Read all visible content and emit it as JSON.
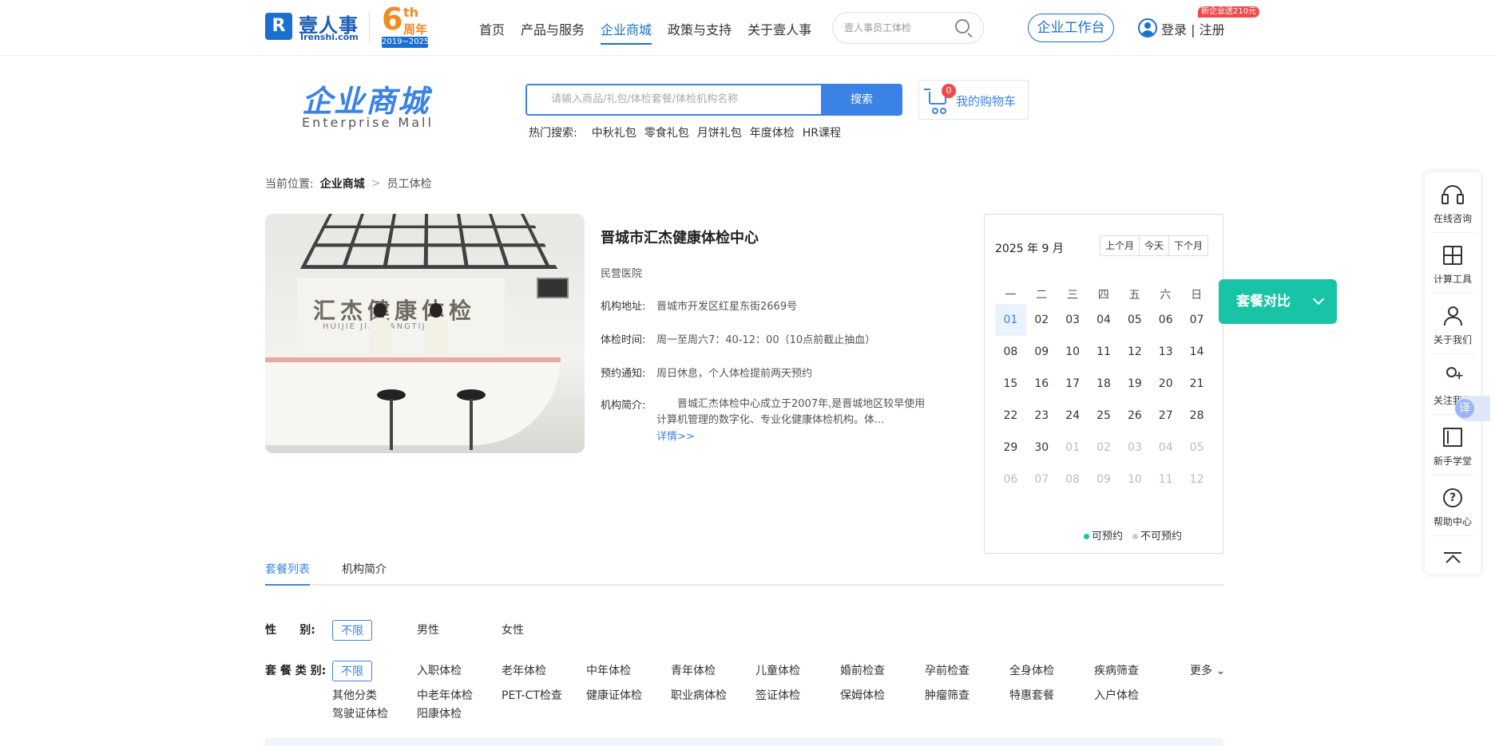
{
  "header": {
    "logo_mark": "R",
    "logo_text": "壹人事",
    "logo_sub": "Irenshi.com",
    "anniversary": {
      "num": "6",
      "th": "th",
      "word": "周年",
      "years": "2019~2025"
    },
    "nav": [
      {
        "label": "首页",
        "active": false
      },
      {
        "label": "产品与服务",
        "active": false
      },
      {
        "label": "企业商城",
        "active": true
      },
      {
        "label": "政策与支持",
        "active": false
      },
      {
        "label": "关于壹人事",
        "active": false
      }
    ],
    "search_placeholder": "壹人事员工体检",
    "workbench_label": "企业工作台",
    "login_label": "登录 | 注册",
    "promo_badge": "新企业送210元"
  },
  "mall": {
    "title": "企业商城",
    "subtitle": "Enterprise  Mall",
    "search_placeholder": "请输入商品/礼包/体检套餐/体检机构名称",
    "search_button": "搜索",
    "cart_count": "0",
    "cart_label": "我的购物车",
    "hot_label": "热门搜索:",
    "hot_items": [
      "中秋礼包",
      "零食礼包",
      "月饼礼包",
      "年度体检",
      "HR课程"
    ]
  },
  "breadcrumb": {
    "prefix": "当前位置:",
    "mall": "企业商城",
    "sep": ">",
    "current": "员工体检"
  },
  "institution": {
    "photo_sign": "汇杰健康体检",
    "photo_sign_sub": "HUIJIE JIANKANGTIJIAN",
    "name": "晋城市汇杰健康体检中心",
    "type": "民营医院",
    "address_label": "机构地址:",
    "address": "晋城市开发区红星东街2669号",
    "hours_label": "体检时间:",
    "hours": "周一至周六7：40-12：00（10点前截止抽血）",
    "notice_label": "预约通知:",
    "notice": "周日休息，个人体检提前两天预约",
    "intro_label": "机构简介:",
    "intro": "晋城汇杰体检中心成立于2007年,是晋城地区较早使用计算机管理的数字化、专业化健康体检机构。体...",
    "detail_link": "详情>>"
  },
  "calendar": {
    "title": "2025 年 9 月",
    "buttons": [
      "上个月",
      "今天",
      "下个月"
    ],
    "weekdays": [
      "一",
      "二",
      "三",
      "四",
      "五",
      "六",
      "日"
    ],
    "days": [
      {
        "d": "01",
        "state": "today"
      },
      {
        "d": "02",
        "state": "normal"
      },
      {
        "d": "03",
        "state": "normal"
      },
      {
        "d": "04",
        "state": "normal"
      },
      {
        "d": "05",
        "state": "normal"
      },
      {
        "d": "06",
        "state": "normal"
      },
      {
        "d": "07",
        "state": "normal"
      },
      {
        "d": "08",
        "state": "normal"
      },
      {
        "d": "09",
        "state": "normal"
      },
      {
        "d": "10",
        "state": "normal"
      },
      {
        "d": "11",
        "state": "normal"
      },
      {
        "d": "12",
        "state": "normal"
      },
      {
        "d": "13",
        "state": "normal"
      },
      {
        "d": "14",
        "state": "normal"
      },
      {
        "d": "15",
        "state": "normal"
      },
      {
        "d": "16",
        "state": "normal"
      },
      {
        "d": "17",
        "state": "normal"
      },
      {
        "d": "18",
        "state": "normal"
      },
      {
        "d": "19",
        "state": "normal"
      },
      {
        "d": "20",
        "state": "normal"
      },
      {
        "d": "21",
        "state": "normal"
      },
      {
        "d": "22",
        "state": "normal"
      },
      {
        "d": "23",
        "state": "normal"
      },
      {
        "d": "24",
        "state": "normal"
      },
      {
        "d": "25",
        "state": "normal"
      },
      {
        "d": "26",
        "state": "normal"
      },
      {
        "d": "27",
        "state": "normal"
      },
      {
        "d": "28",
        "state": "normal"
      },
      {
        "d": "29",
        "state": "normal"
      },
      {
        "d": "30",
        "state": "normal"
      },
      {
        "d": "01",
        "state": "muted"
      },
      {
        "d": "02",
        "state": "muted"
      },
      {
        "d": "03",
        "state": "muted"
      },
      {
        "d": "04",
        "state": "muted"
      },
      {
        "d": "05",
        "state": "muted"
      },
      {
        "d": "06",
        "state": "muted"
      },
      {
        "d": "07",
        "state": "muted"
      },
      {
        "d": "08",
        "state": "muted"
      },
      {
        "d": "09",
        "state": "muted"
      },
      {
        "d": "10",
        "state": "muted"
      },
      {
        "d": "11",
        "state": "muted"
      },
      {
        "d": "12",
        "state": "muted"
      }
    ],
    "legend_available": "可预约",
    "legend_unavailable": "不可预约",
    "colors": {
      "available": "#19c3a6",
      "unavailable": "#cccccc"
    }
  },
  "compare_button": "套餐对比",
  "sidebar": {
    "items": [
      {
        "label": "在线咨询",
        "icon": "headset-icon"
      },
      {
        "label": "计算工具",
        "icon": "calculator-icon"
      },
      {
        "label": "关于我们",
        "icon": "user-icon"
      },
      {
        "label": "关注我们",
        "icon": "follow-icon"
      },
      {
        "label": "新手学堂",
        "icon": "book-icon"
      },
      {
        "label": "帮助中心",
        "icon": "help-icon"
      }
    ],
    "translate": "译"
  },
  "tabs": [
    {
      "label": "套餐列表",
      "active": true
    },
    {
      "label": "机构简介",
      "active": false
    }
  ],
  "filters": {
    "gender_label": "性      别:",
    "gender_options": [
      "不限",
      "男性",
      "女性"
    ],
    "category_label": "套 餐 类 别:",
    "category_options": [
      "不限",
      "入职体检",
      "老年体检",
      "中年体检",
      "青年体检",
      "儿童体检",
      "婚前检查",
      "孕前检查",
      "全身体检",
      "疾病筛查",
      "其他分类",
      "中老年体检",
      "PET-CT检查",
      "健康证体检",
      "职业病体检",
      "签证体检",
      "保姆体检",
      "肿瘤筛查",
      "特惠套餐",
      "入户体检",
      "驾驶证体检",
      "阳康体检"
    ],
    "more_label": "更多"
  },
  "colors": {
    "accent": "#3b82e6",
    "brand_dark": "#1a6fd1",
    "teal": "#19c3a6",
    "promo_red": "#f04b4b",
    "anniversary_orange": "#f38a1f"
  }
}
